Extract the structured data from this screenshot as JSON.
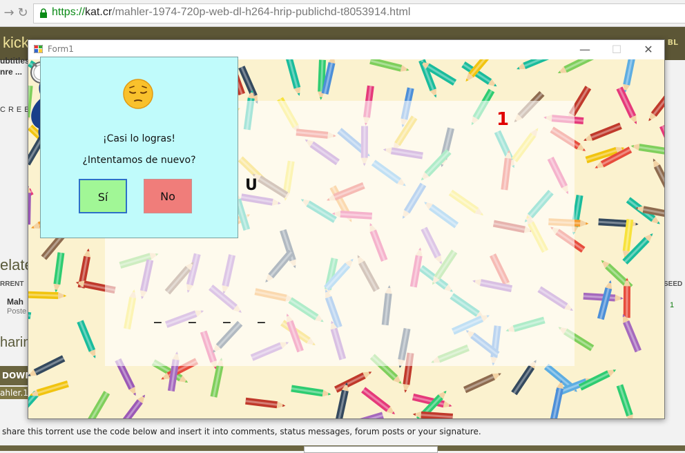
{
  "browser": {
    "url_scheme": "https://",
    "url_host": "kat.cr",
    "url_path": "/mahler-1974-720p-web-dl-h264-hrip-publichd-t8053914.html"
  },
  "site": {
    "logo": "kick",
    "header_right": "BL",
    "fragment_1": "ubtitles",
    "fragment_2": "nre ...",
    "fragment_3": "CREE",
    "related": "elated",
    "col_left": "RRENT",
    "col_right": "SEED",
    "row_title": "Mah",
    "row_sub": "Poste",
    "seed_value": "1",
    "sharing": "harin",
    "download": "DOWN",
    "filename": "ahler.1",
    "share_text": "share this torrent use the code below and insert it into comments, status messages, forum posts or your signature."
  },
  "window": {
    "title": "Form1",
    "minimize": "—",
    "maximize": "☐",
    "close": "✕"
  },
  "game": {
    "letter": "U",
    "score": "1",
    "slots": [
      "_",
      "_",
      "_",
      "_"
    ]
  },
  "dialog": {
    "line1": "¡Casi lo logras!",
    "line2": "¿Intentamos de nuevo?",
    "yes_label": "Sí",
    "no_label": "No"
  },
  "colors": {
    "dialog_bg": "#c0fbfb",
    "yes_bg": "#a1f796",
    "no_bg": "#f07d7a",
    "score": "#e00000",
    "site_header": "#5c5636"
  }
}
